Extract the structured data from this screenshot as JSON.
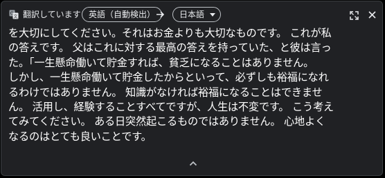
{
  "toolbar": {
    "status_text": "翻訳しています",
    "source_language": "英語（自動検出）",
    "target_language": "日本語",
    "icons": {
      "translate": "google-translate-icon",
      "arrow": "arrow-right-icon",
      "dropdown": "caret-down-icon",
      "expand": "open-in-panel-icon",
      "close": "close-icon"
    }
  },
  "translation": {
    "lines": [
      "を大切にしてください。それはお金よりも大切なものです。 これが私",
      "の答えです。 父はこれに対する最高の答えを持っていた、と彼は言っ",
      "た。「一生懸命働いて貯金すれば、貧乏になることはありません。",
      "しかし、一生懸命働いて貯金したからといって、必ずしも裕福になれ",
      "るわけではありません。 知識がなければ裕福になることはできませ",
      "ん。 活用し、経験することすべてですが、人生は不変です。 こう考え",
      "てみてください。 ある日突然起こるものではありません。 心地よく",
      "なるのはとても良いことです。"
    ]
  },
  "footer": {
    "collapse_icon": "chevron-up-icon"
  },
  "colors": {
    "panel_background": "#202124",
    "text": "#ffffff",
    "chip_border": "#bdc1c6"
  }
}
